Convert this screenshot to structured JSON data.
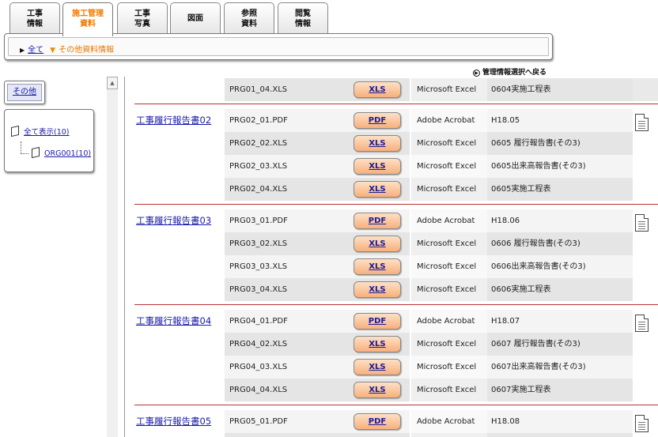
{
  "tabs": [
    {
      "line1": "工事",
      "line2": "情報"
    },
    {
      "line1": "施工管理",
      "line2": "資料"
    },
    {
      "line1": "工事",
      "line2": "写真"
    },
    {
      "line1": "図面",
      "line2": ""
    },
    {
      "line1": "参照",
      "line2": "資料"
    },
    {
      "line1": "閲覧",
      "line2": "情報"
    }
  ],
  "breadcrumb": {
    "root": "全て",
    "current": "その他資料情報"
  },
  "back_link": "管理情報選択へ戻る",
  "left": {
    "category_button": "その他",
    "tree_all": "全て表示(10)",
    "tree_child": "ORG001(10)"
  },
  "top_row": {
    "file": "PRG01_04.XLS",
    "btn": "XLS",
    "app": "Microsoft Excel",
    "desc": "0604実施工程表"
  },
  "groups": [
    {
      "title": "工事履行報告書02",
      "rows": [
        {
          "file": "PRG02_01.PDF",
          "btn": "PDF",
          "app": "Adobe Acrobat",
          "desc": "H18.05"
        },
        {
          "file": "PRG02_02.XLS",
          "btn": "XLS",
          "app": "Microsoft Excel",
          "desc": "0605 履行報告書(その3)"
        },
        {
          "file": "PRG02_03.XLS",
          "btn": "XLS",
          "app": "Microsoft Excel",
          "desc": "0605出来高報告書(その3)"
        },
        {
          "file": "PRG02_04.XLS",
          "btn": "XLS",
          "app": "Microsoft Excel",
          "desc": "0605実施工程表"
        }
      ]
    },
    {
      "title": "工事履行報告書03",
      "rows": [
        {
          "file": "PRG03_01.PDF",
          "btn": "PDF",
          "app": "Adobe Acrobat",
          "desc": "H18.06"
        },
        {
          "file": "PRG03_02.XLS",
          "btn": "XLS",
          "app": "Microsoft Excel",
          "desc": "0606 履行報告書(その3)"
        },
        {
          "file": "PRG03_03.XLS",
          "btn": "XLS",
          "app": "Microsoft Excel",
          "desc": "0606出来高報告書(その3)"
        },
        {
          "file": "PRG03_04.XLS",
          "btn": "XLS",
          "app": "Microsoft Excel",
          "desc": "0606実施工程表"
        }
      ]
    },
    {
      "title": "工事履行報告書04",
      "rows": [
        {
          "file": "PRG04_01.PDF",
          "btn": "PDF",
          "app": "Adobe Acrobat",
          "desc": "H18.07"
        },
        {
          "file": "PRG04_02.XLS",
          "btn": "XLS",
          "app": "Microsoft Excel",
          "desc": "0607 履行報告書(その3)"
        },
        {
          "file": "PRG04_03.XLS",
          "btn": "XLS",
          "app": "Microsoft Excel",
          "desc": "0607出来高報告書(その3)"
        },
        {
          "file": "PRG04_04.XLS",
          "btn": "XLS",
          "app": "Microsoft Excel",
          "desc": "0607実施工程表"
        }
      ]
    },
    {
      "title": "工事履行報告書05",
      "rows": [
        {
          "file": "PRG05_01.PDF",
          "btn": "PDF",
          "app": "Adobe Acrobat",
          "desc": "H18.08"
        }
      ]
    }
  ]
}
